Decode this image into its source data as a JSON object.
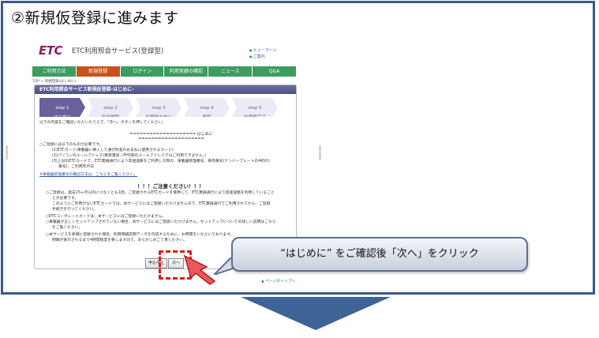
{
  "step_heading": "②新規仮登録に進みます",
  "site": {
    "logo": "ETC",
    "title": "ETC利用照会サービス(登録型)",
    "header_links": [
      "ヒューマーン",
      "ご案内"
    ],
    "nav": [
      "ご利用方法",
      "新規登録",
      "ログイン",
      "利用実績の確認",
      "ニュース",
      "Q&A"
    ],
    "breadcrumb": "TOP > 新規登録(はじめに)",
    "card_title": "ETC利用照会サービス新規仮登録-はじめに-",
    "steps": [
      {
        "num": "step 1",
        "label": "はじめに"
      },
      {
        "num": "step 2",
        "label": "利用規程"
      },
      {
        "num": "step 3",
        "label": "仮登録お申込"
      },
      {
        "num": "step 4",
        "label": "確認"
      },
      {
        "num": "step 5",
        "label": "仮登録完了"
      }
    ],
    "intro": "以下の内容をご確認いただいたうえで、「次へ」ボタンを押してください。",
    "section_header": "==================== はじめに ====================",
    "body_lines": [
      "○ご登録には以下のものが必要です。",
      "(1)ETCカード(車載器に挿入して通行料金のお支払に使用されるカード)",
      "(2)パソコンのメールアドレス(携帯電話・PHS等のメールアドレスではご利用できません。)",
      "(3)上記のETCカードで、ETC無線通行により高速道路をご利用した際の、車載器管理番号、車両番号(ナンバープレートの4桁の)",
      "番号)、ご利用年月日"
    ],
    "link_line": "※車載器管理番号の確認方法は、こちらをご覧ください。",
    "caution_title": "！！！ご注意ください！！！",
    "caution_lines": [
      "○ご登録は、過去15ヶ月以内に少なくとも1回、ご登録されるETCカードを使用して、ETC無線通行により高速道路を利用していること",
      "とが必要です。",
      "このようにご利用がないETCカードでは、本サービスにはご登録いただけませんので、ETC無線通行でご利用されてから、ご登録",
      "手続きを行ってください。",
      "○ETCコーポレートカードは、本サービスにはご登録いただけません。",
      "○車載器が正しくセットアップされていない場合、本サービスにはご登録いただけません。セットアップについての詳しい説明はこちら",
      "をご覧ください。",
      "○本サービスを新規に登録された場合、利用明細説明データを作成するために、お時間をいただいております。",
      "明細が表示されるまで4時間程度を要しますので、あらかじめご了承ください。"
    ],
    "btn_cancel": "申込中止",
    "btn_next": "次へ",
    "page_top": "ページのトップへ"
  },
  "callout": "“はじめに” をご確認後「次へ」をクリック",
  "colors": {
    "frame": "#3a5b8a",
    "nav": "#3d9c5f",
    "nav_active": "#c8531b",
    "accent": "#6b5f9e",
    "highlight": "#e01818"
  }
}
